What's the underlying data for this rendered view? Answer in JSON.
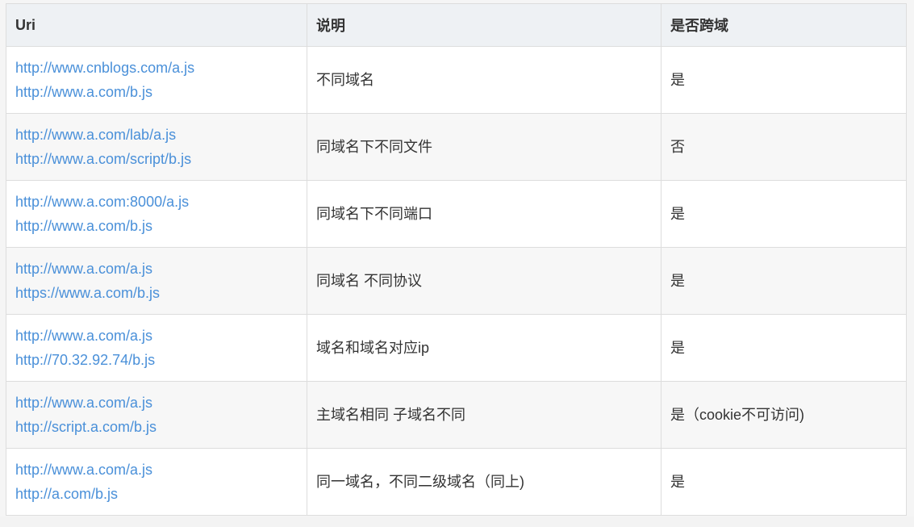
{
  "table": {
    "headers": {
      "uri": "Uri",
      "description": "说明",
      "cross_domain": "是否跨域"
    },
    "rows": [
      {
        "uris": [
          "http://www.cnblogs.com/a.js",
          "http://www.a.com/b.js"
        ],
        "description": "不同域名",
        "cross_domain": "是"
      },
      {
        "uris": [
          "http://www.a.com/lab/a.js",
          "http://www.a.com/script/b.js"
        ],
        "description": "同域名下不同文件",
        "cross_domain": "否"
      },
      {
        "uris": [
          "http://www.a.com:8000/a.js",
          "http://www.a.com/b.js"
        ],
        "description": "同域名下不同端口",
        "cross_domain": "是"
      },
      {
        "uris": [
          "http://www.a.com/a.js",
          "https://www.a.com/b.js"
        ],
        "description": "同域名 不同协议",
        "cross_domain": "是"
      },
      {
        "uris": [
          "http://www.a.com/a.js",
          "http://70.32.92.74/b.js"
        ],
        "description": "域名和域名对应ip",
        "cross_domain": "是"
      },
      {
        "uris": [
          "http://www.a.com/a.js",
          "http://script.a.com/b.js"
        ],
        "description": "主域名相同 子域名不同",
        "cross_domain": "是（cookie不可访问)"
      },
      {
        "uris": [
          "http://www.a.com/a.js",
          "http://a.com/b.js"
        ],
        "description": "同一域名，不同二级域名（同上)",
        "cross_domain": "是"
      }
    ]
  },
  "colors": {
    "link": "#4a90d9",
    "text": "#333333",
    "header_bg": "#eef1f4",
    "border": "#dddddd",
    "stripe_bg": "#f7f7f7"
  }
}
